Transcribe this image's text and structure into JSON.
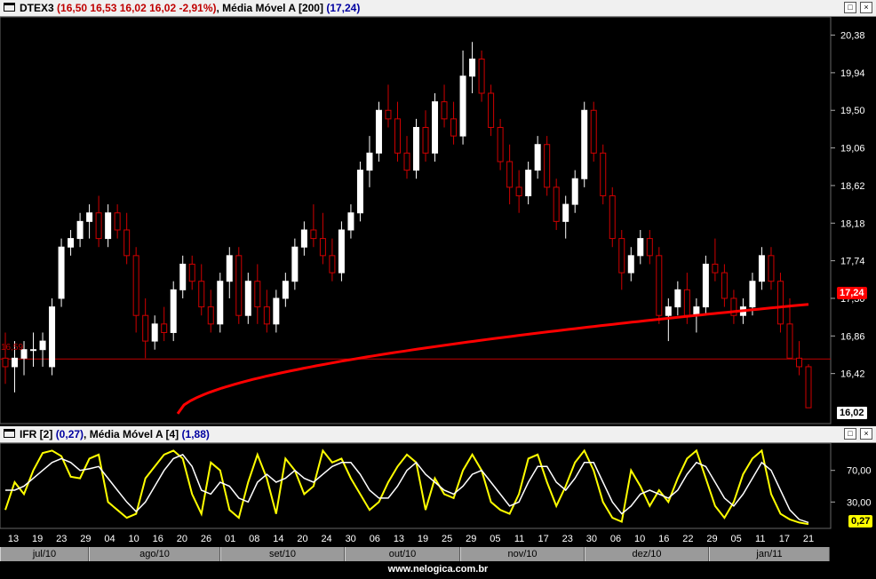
{
  "price_panel": {
    "title_symbol": "DTEX3",
    "title_quote": "(16,50  16,53  16,02  16,02  -2,91%)",
    "title_ma_label": ", Média Móvel A [200]",
    "title_ma_value": "(17,24)",
    "current_price_tag": "16,02",
    "ma_value_tag": "17,24",
    "line_label": "16,59"
  },
  "ifr_panel": {
    "title_prefix": "IFR [2]",
    "title_value": "(0,27)",
    "title_ma_label": ", Média Móvel A [4]",
    "title_ma_value": "(1,88)",
    "current_value_tag": "0,27"
  },
  "window_buttons": {
    "restore": "□",
    "close": "×"
  },
  "day_labels": [
    "13",
    "19",
    "23",
    "29",
    "04",
    "10",
    "16",
    "20",
    "26",
    "01",
    "08",
    "14",
    "20",
    "24",
    "30",
    "06",
    "13",
    "19",
    "25",
    "29",
    "05",
    "11",
    "17",
    "23",
    "30",
    "06",
    "10",
    "16",
    "22",
    "29",
    "05",
    "11",
    "17",
    "21"
  ],
  "month_labels": [
    "jul/10",
    "ago/10",
    "set/10",
    "out/10",
    "nov/10",
    "dez/10",
    "jan/11"
  ],
  "watermark": "www.nelogica.com.br",
  "colors": {
    "up": "#ffffff",
    "down": "#d00000",
    "ma": "#ff0000",
    "ifr": "#ffff00",
    "ifr_ma": "#ffffff",
    "tag_red": "#ff0000",
    "tag_yellow": "#ffff00"
  },
  "chart_data": [
    {
      "type": "candlestick",
      "y_ticks": [
        "20,38",
        "19,94",
        "19,50",
        "19,06",
        "18,62",
        "18,18",
        "17,74",
        "17,30",
        "16,86",
        "16,42"
      ],
      "ylim": [
        15.98,
        20.5
      ],
      "horizontal_line": 16.59,
      "ohlc": [
        [
          16.6,
          16.9,
          16.3,
          16.5
        ],
        [
          16.5,
          16.8,
          16.2,
          16.6
        ],
        [
          16.6,
          16.8,
          16.4,
          16.7
        ],
        [
          16.7,
          16.9,
          16.5,
          16.7
        ],
        [
          16.7,
          16.9,
          16.5,
          16.8
        ],
        [
          16.5,
          17.3,
          16.4,
          17.2
        ],
        [
          17.3,
          18.0,
          17.2,
          17.9
        ],
        [
          17.9,
          18.1,
          17.8,
          18.0
        ],
        [
          18.0,
          18.3,
          17.9,
          18.2
        ],
        [
          18.2,
          18.4,
          18.0,
          18.3
        ],
        [
          18.3,
          18.5,
          17.9,
          18.0
        ],
        [
          18.0,
          18.4,
          17.9,
          18.3
        ],
        [
          18.3,
          18.4,
          18.0,
          18.1
        ],
        [
          18.1,
          18.3,
          17.7,
          17.8
        ],
        [
          17.8,
          17.9,
          16.9,
          17.1
        ],
        [
          17.1,
          17.3,
          16.6,
          16.8
        ],
        [
          16.8,
          17.1,
          16.7,
          17.0
        ],
        [
          17.0,
          17.2,
          16.8,
          16.9
        ],
        [
          16.9,
          17.5,
          16.8,
          17.4
        ],
        [
          17.4,
          17.8,
          17.3,
          17.7
        ],
        [
          17.7,
          17.8,
          17.4,
          17.5
        ],
        [
          17.5,
          17.7,
          17.1,
          17.2
        ],
        [
          17.2,
          17.4,
          16.9,
          17.0
        ],
        [
          17.0,
          17.6,
          16.9,
          17.5
        ],
        [
          17.5,
          17.9,
          17.3,
          17.8
        ],
        [
          17.8,
          17.9,
          17.0,
          17.1
        ],
        [
          17.1,
          17.6,
          17.0,
          17.5
        ],
        [
          17.5,
          17.7,
          17.0,
          17.2
        ],
        [
          17.2,
          17.4,
          16.9,
          17.0
        ],
        [
          17.0,
          17.4,
          16.9,
          17.3
        ],
        [
          17.3,
          17.6,
          17.2,
          17.5
        ],
        [
          17.5,
          18.0,
          17.4,
          17.9
        ],
        [
          17.9,
          18.2,
          17.8,
          18.1
        ],
        [
          18.1,
          18.4,
          17.9,
          18.0
        ],
        [
          18.0,
          18.3,
          17.7,
          17.8
        ],
        [
          17.8,
          18.0,
          17.5,
          17.6
        ],
        [
          17.6,
          18.2,
          17.5,
          18.1
        ],
        [
          18.1,
          18.4,
          18.0,
          18.3
        ],
        [
          18.3,
          18.9,
          18.2,
          18.8
        ],
        [
          18.8,
          19.2,
          18.6,
          19.0
        ],
        [
          19.0,
          19.6,
          18.9,
          19.5
        ],
        [
          19.5,
          19.8,
          19.3,
          19.4
        ],
        [
          19.4,
          19.6,
          18.9,
          19.0
        ],
        [
          19.0,
          19.2,
          18.7,
          18.8
        ],
        [
          18.8,
          19.4,
          18.7,
          19.3
        ],
        [
          19.3,
          19.5,
          18.9,
          19.0
        ],
        [
          19.0,
          19.7,
          18.9,
          19.6
        ],
        [
          19.6,
          19.8,
          19.3,
          19.4
        ],
        [
          19.4,
          19.6,
          19.1,
          19.2
        ],
        [
          19.2,
          20.2,
          19.1,
          19.9
        ],
        [
          19.9,
          20.3,
          19.7,
          20.1
        ],
        [
          20.1,
          20.2,
          19.6,
          19.7
        ],
        [
          19.7,
          19.8,
          19.2,
          19.3
        ],
        [
          19.3,
          19.4,
          18.8,
          18.9
        ],
        [
          18.9,
          19.1,
          18.4,
          18.6
        ],
        [
          18.6,
          18.8,
          18.3,
          18.5
        ],
        [
          18.5,
          18.9,
          18.4,
          18.8
        ],
        [
          18.8,
          19.2,
          18.7,
          19.1
        ],
        [
          19.1,
          19.2,
          18.5,
          18.6
        ],
        [
          18.6,
          18.7,
          18.1,
          18.2
        ],
        [
          18.2,
          18.5,
          18.0,
          18.4
        ],
        [
          18.4,
          18.8,
          18.3,
          18.7
        ],
        [
          18.7,
          19.6,
          18.6,
          19.5
        ],
        [
          19.5,
          19.6,
          18.9,
          19.0
        ],
        [
          19.0,
          19.1,
          18.4,
          18.5
        ],
        [
          18.5,
          18.6,
          17.9,
          18.0
        ],
        [
          18.0,
          18.1,
          17.4,
          17.6
        ],
        [
          17.6,
          17.9,
          17.5,
          17.8
        ],
        [
          17.8,
          18.1,
          17.7,
          18.0
        ],
        [
          18.0,
          18.1,
          17.7,
          17.8
        ],
        [
          17.8,
          17.9,
          17.0,
          17.1
        ],
        [
          17.1,
          17.3,
          16.8,
          17.2
        ],
        [
          17.2,
          17.5,
          17.1,
          17.4
        ],
        [
          17.4,
          17.6,
          17.0,
          17.1
        ],
        [
          17.1,
          17.3,
          16.9,
          17.2
        ],
        [
          17.2,
          17.8,
          17.1,
          17.7
        ],
        [
          17.7,
          18.0,
          17.5,
          17.6
        ],
        [
          17.6,
          17.7,
          17.2,
          17.3
        ],
        [
          17.3,
          17.4,
          17.0,
          17.1
        ],
        [
          17.1,
          17.3,
          17.0,
          17.2
        ],
        [
          17.2,
          17.6,
          17.1,
          17.5
        ],
        [
          17.5,
          17.9,
          17.4,
          17.8
        ],
        [
          17.8,
          17.9,
          17.4,
          17.5
        ],
        [
          17.5,
          17.6,
          16.9,
          17.0
        ],
        [
          17.0,
          17.3,
          16.8,
          16.6
        ],
        [
          16.6,
          16.8,
          16.4,
          16.5
        ],
        [
          16.5,
          16.53,
          16.02,
          16.02
        ]
      ],
      "moving_average": {
        "name": "Média Móvel A [200]",
        "value": 17.24
      }
    },
    {
      "type": "line",
      "y_ticks": [
        "70,00",
        "30,00"
      ],
      "ylim": [
        0,
        100
      ],
      "series": [
        {
          "name": "IFR [2]",
          "values": [
            20,
            55,
            40,
            70,
            92,
            95,
            88,
            62,
            60,
            85,
            90,
            30,
            20,
            10,
            15,
            60,
            75,
            90,
            95,
            85,
            40,
            15,
            80,
            70,
            20,
            10,
            55,
            90,
            60,
            15,
            85,
            70,
            40,
            50,
            95,
            80,
            85,
            60,
            40,
            20,
            30,
            55,
            75,
            90,
            80,
            20,
            60,
            40,
            35,
            70,
            90,
            70,
            30,
            20,
            15,
            40,
            85,
            90,
            55,
            25,
            50,
            80,
            95,
            70,
            30,
            10,
            5,
            70,
            50,
            25,
            45,
            30,
            60,
            85,
            95,
            60,
            25,
            10,
            30,
            65,
            85,
            95,
            40,
            15,
            8,
            4,
            2
          ]
        },
        {
          "name": "Média Móvel A [4]",
          "values": [
            45,
            45,
            50,
            60,
            70,
            80,
            85,
            80,
            70,
            72,
            75,
            60,
            45,
            30,
            18,
            30,
            50,
            70,
            85,
            90,
            75,
            45,
            40,
            55,
            50,
            35,
            30,
            55,
            65,
            55,
            60,
            70,
            60,
            55,
            65,
            75,
            80,
            80,
            65,
            45,
            35,
            35,
            50,
            70,
            80,
            65,
            55,
            45,
            40,
            50,
            65,
            70,
            55,
            40,
            25,
            30,
            55,
            75,
            75,
            55,
            45,
            60,
            80,
            80,
            55,
            30,
            15,
            25,
            40,
            45,
            40,
            35,
            45,
            65,
            80,
            75,
            55,
            35,
            25,
            40,
            60,
            80,
            70,
            45,
            20,
            8,
            4
          ]
        }
      ]
    }
  ]
}
